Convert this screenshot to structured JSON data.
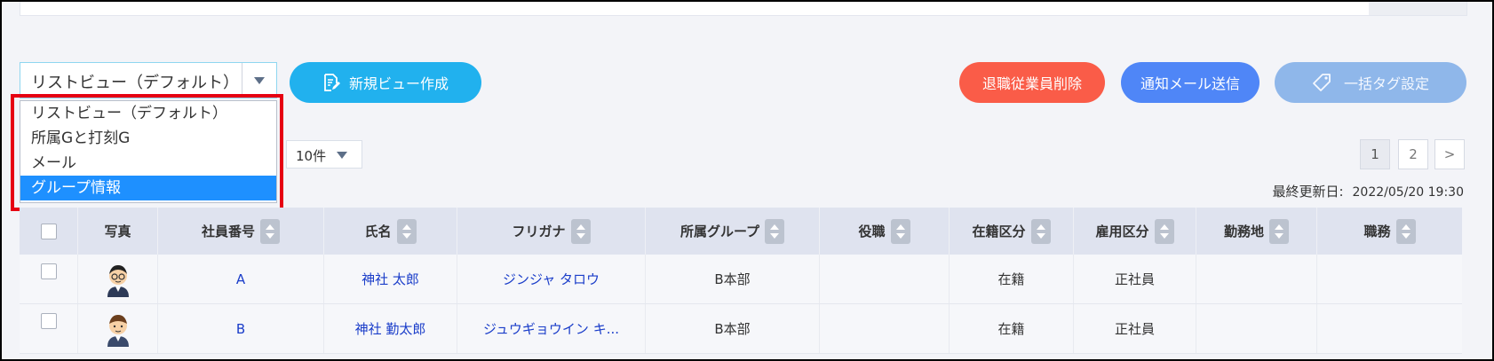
{
  "view_selector": {
    "value": "リストビュー（デフォルト）"
  },
  "view_options": [
    {
      "label": "リストビュー（デフォルト）",
      "selected": false
    },
    {
      "label": "所属Gと打刻G",
      "selected": false
    },
    {
      "label": "メール",
      "selected": false
    },
    {
      "label": "グループ情報",
      "selected": true
    }
  ],
  "toolbar": {
    "new_view_label": "新規ビュー作成",
    "retire_delete_label": "退職従業員削除",
    "notify_mail_label": "通知メール送信",
    "bulk_tag_label": "一括タグ設定"
  },
  "per_page": {
    "value": "10件"
  },
  "pagination": {
    "pages": [
      "1",
      "2"
    ],
    "current": "1",
    "next": ">"
  },
  "last_updated": {
    "label": "最終更新日:",
    "value": "2022/05/20 19:30"
  },
  "table": {
    "headers": [
      "",
      "写真",
      "社員番号",
      "氏名",
      "フリガナ",
      "所属グループ",
      "役職",
      "在籍区分",
      "雇用区分",
      "勤務地",
      "職務"
    ],
    "rows": [
      {
        "emp_no": "A",
        "name": "神社 太郎",
        "kana": "ジンジャ タロウ",
        "group": "B本部",
        "title": "",
        "status": "在籍",
        "employment": "正社員",
        "location": "",
        "duty": ""
      },
      {
        "emp_no": "B",
        "name": "神社 勤太郎",
        "kana": "ジュウギョウイン キ...",
        "group": "B本部",
        "title": "",
        "status": "在籍",
        "employment": "正社員",
        "location": "",
        "duty": ""
      }
    ]
  },
  "colors": {
    "new_view": "#21b1ee",
    "retire_delete": "#fa5c48",
    "notify_mail": "#4f86f7",
    "bulk_tag": "#8fb7ea",
    "selected_option": "#1e90ff",
    "highlight_box": "#e60012",
    "link": "#1a3dc9"
  },
  "icons": {
    "new_view": "document-edit-icon",
    "bulk_tag": "tag-icon",
    "dropdown": "caret-down-icon",
    "sort": "sort-icon",
    "avatar": "avatar-icon"
  }
}
